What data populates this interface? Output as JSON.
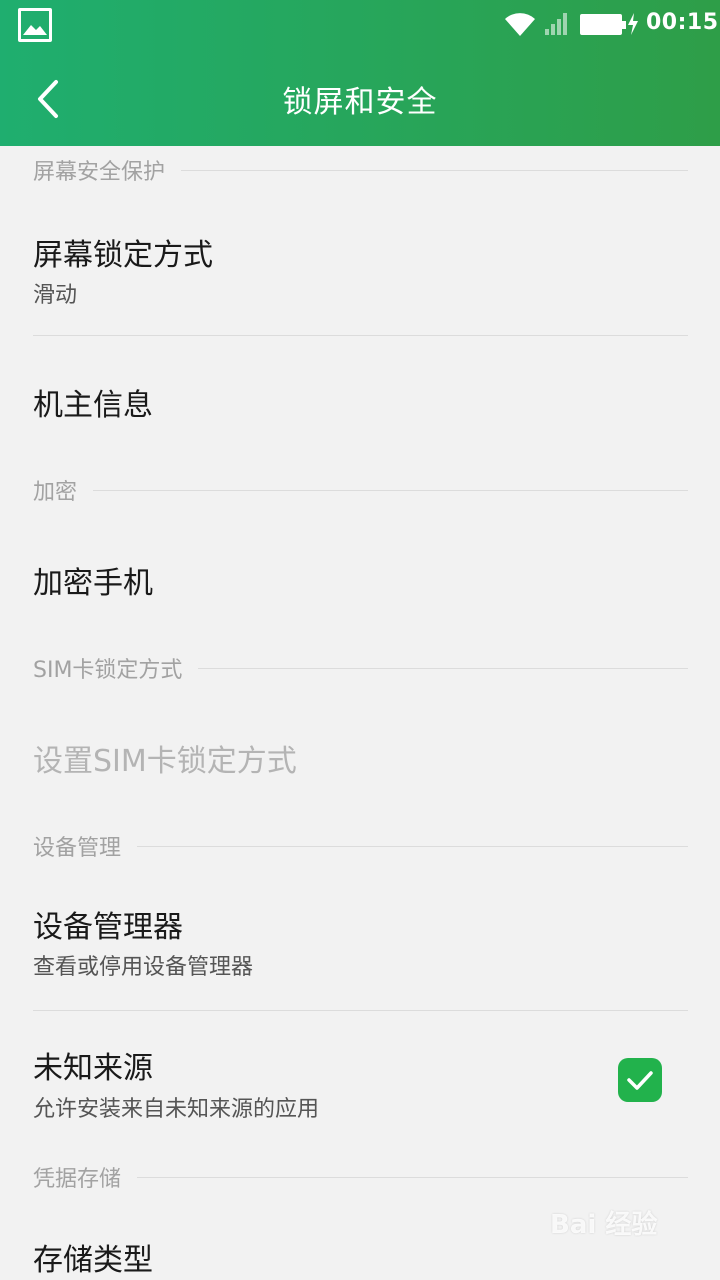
{
  "status_bar": {
    "time": "00:15"
  },
  "header": {
    "title": "锁屏和安全"
  },
  "sections": {
    "screen_security": {
      "header": "屏幕安全保护",
      "lock_method_title": "屏幕锁定方式",
      "lock_method_value": "滑动",
      "owner_info_title": "机主信息"
    },
    "encryption": {
      "header": "加密",
      "encrypt_phone_title": "加密手机"
    },
    "sim_lock": {
      "header": "SIM卡锁定方式",
      "set_sim_lock_title": "设置SIM卡锁定方式"
    },
    "device_admin": {
      "header": "设备管理",
      "device_admins_title": "设备管理器",
      "device_admins_subtitle": "查看或停用设备管理器",
      "unknown_sources_title": "未知来源",
      "unknown_sources_subtitle": "允许安装来自未知来源的应用",
      "unknown_sources_checked": true
    },
    "credential_storage": {
      "header": "凭据存储",
      "storage_type_title": "存储类型"
    }
  },
  "watermark": "Bai 经验",
  "colors": {
    "header_start": "#1fae6f",
    "header_end": "#2e9e48",
    "checkbox": "#22b24c"
  }
}
